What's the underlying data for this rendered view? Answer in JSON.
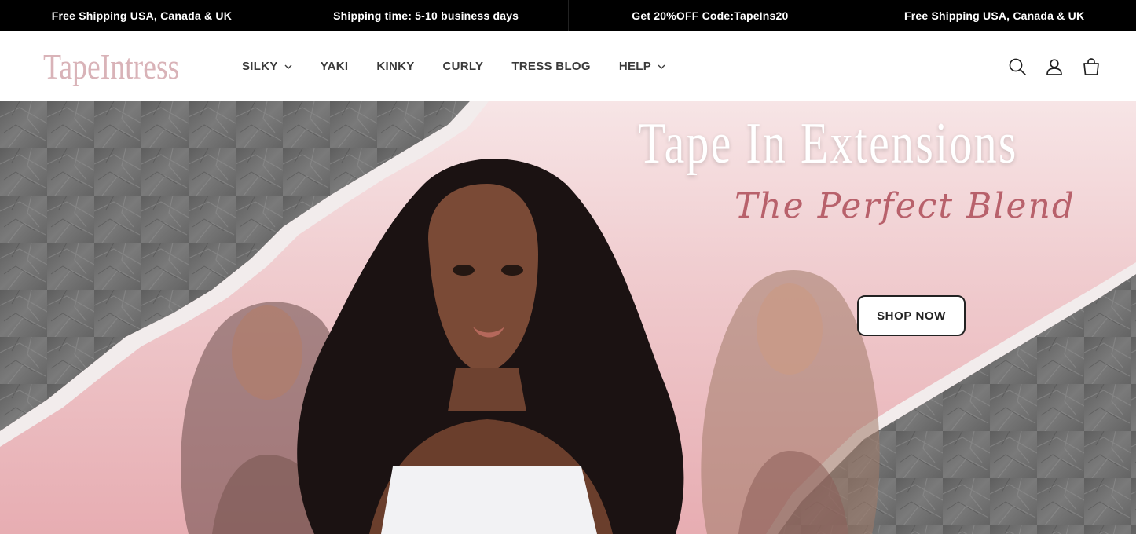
{
  "announcements": [
    "Free Shipping USA, Canada & UK",
    "Shipping time: 5-10 business days",
    "Get 20%OFF Code:TapeIns20",
    "Free Shipping USA, Canada & UK"
  ],
  "header": {
    "logo": "TapeIntress",
    "nav": [
      {
        "label": "SILKY",
        "has_dropdown": true
      },
      {
        "label": "YAKI",
        "has_dropdown": false
      },
      {
        "label": "KINKY",
        "has_dropdown": false
      },
      {
        "label": "CURLY",
        "has_dropdown": false
      },
      {
        "label": "TRESS BLOG",
        "has_dropdown": false
      },
      {
        "label": "HELP",
        "has_dropdown": true
      }
    ],
    "icons": [
      "search-icon",
      "account-icon",
      "cart-icon"
    ]
  },
  "hero": {
    "title": "Tape In Extensions",
    "subtitle": "The Perfect Blend",
    "cta_label": "SHOP NOW"
  },
  "colors": {
    "announcement_bg": "#000000",
    "logo": "#d9b3b8",
    "subtitle": "#b8616b",
    "hero_pink": "#efc9cc"
  }
}
